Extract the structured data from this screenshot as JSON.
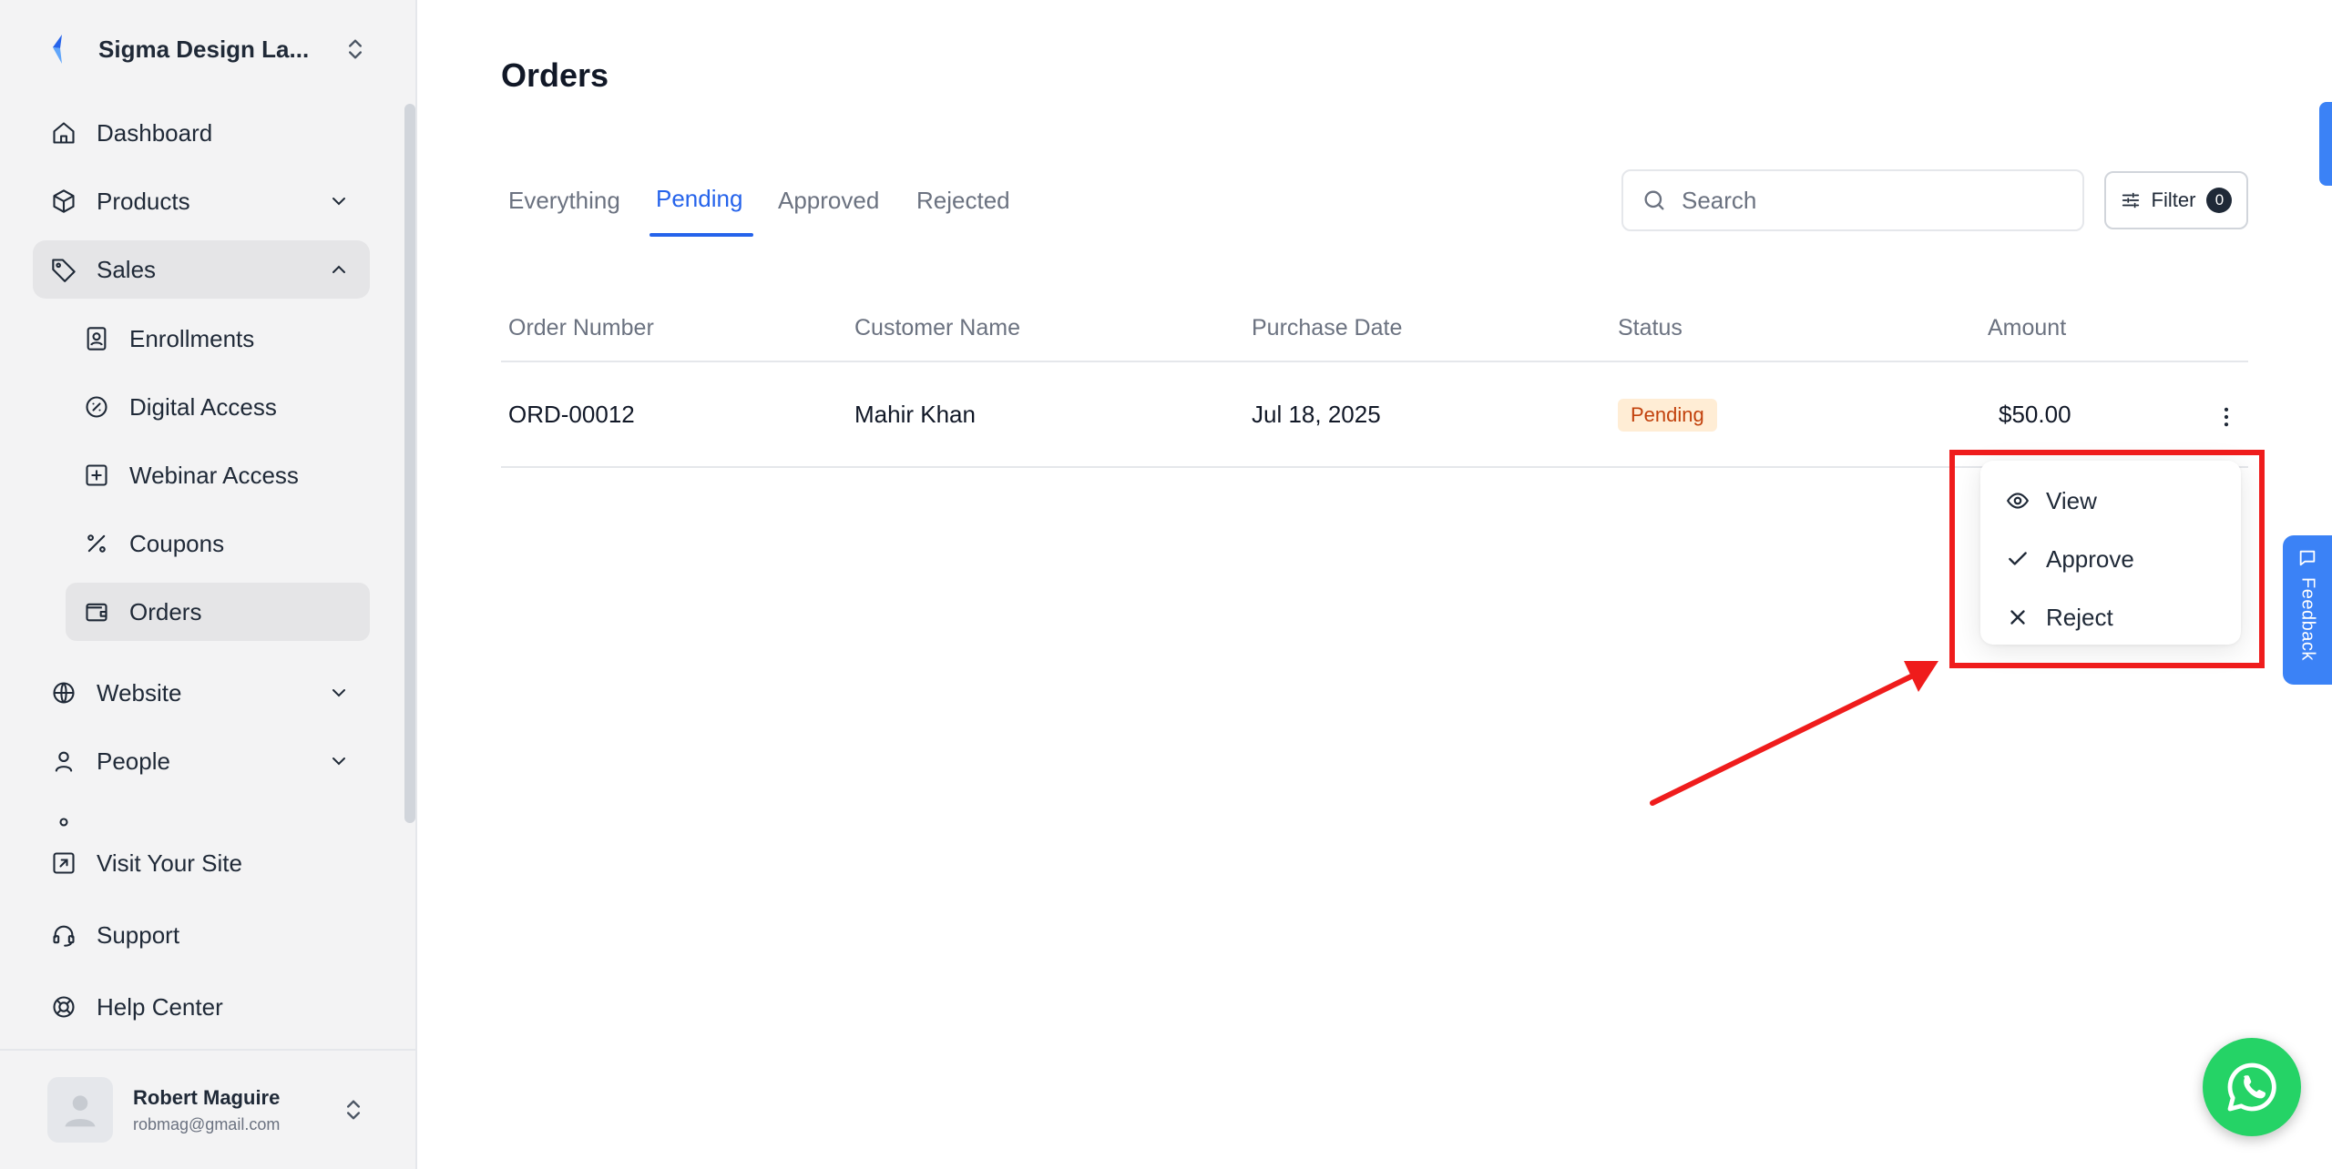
{
  "workspace": {
    "name": "Sigma Design La..."
  },
  "sidebar": {
    "items": [
      {
        "label": "Dashboard"
      },
      {
        "label": "Products"
      },
      {
        "label": "Sales"
      },
      {
        "label": "Website"
      },
      {
        "label": "People"
      }
    ],
    "sales_sub": [
      {
        "label": "Enrollments"
      },
      {
        "label": "Digital Access"
      },
      {
        "label": "Webinar Access"
      },
      {
        "label": "Coupons"
      },
      {
        "label": "Orders"
      }
    ],
    "bottom_links": [
      {
        "label": "Visit Your Site"
      },
      {
        "label": "Support"
      },
      {
        "label": "Help Center"
      }
    ]
  },
  "user": {
    "name": "Robert Maguire",
    "email": "robmag@gmail.com"
  },
  "page": {
    "title": "Orders"
  },
  "tabs": [
    {
      "label": "Everything"
    },
    {
      "label": "Pending",
      "active": true
    },
    {
      "label": "Approved"
    },
    {
      "label": "Rejected"
    }
  ],
  "search": {
    "placeholder": "Search",
    "value": ""
  },
  "filter": {
    "label": "Filter",
    "count": "0"
  },
  "table": {
    "headers": [
      "Order Number",
      "Customer Name",
      "Purchase Date",
      "Status",
      "Amount"
    ],
    "rows": [
      {
        "order": "ORD-00012",
        "customer": "Mahir Khan",
        "date": "Jul 18, 2025",
        "status": "Pending",
        "amount": "$50.00"
      }
    ]
  },
  "row_menu": {
    "items": [
      {
        "label": "View",
        "icon": "eye-icon"
      },
      {
        "label": "Approve",
        "icon": "check-icon"
      },
      {
        "label": "Reject",
        "icon": "x-icon"
      }
    ]
  },
  "feedback": {
    "label": "Feedback"
  },
  "colors": {
    "accent": "#2563eb",
    "annotation": "#ef1c1c",
    "whatsapp": "#25d366",
    "pending_bg": "#ffedd5",
    "pending_text": "#c2410c"
  }
}
